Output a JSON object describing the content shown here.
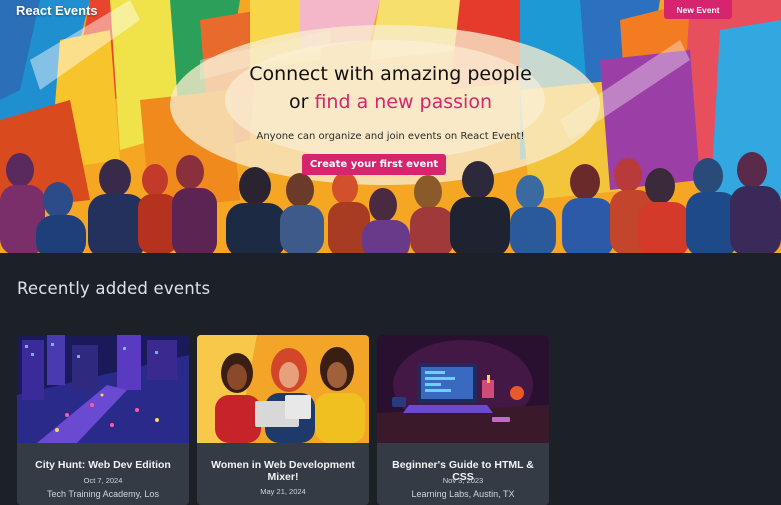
{
  "header": {
    "brand": "React Events",
    "new_event_label": "New Event"
  },
  "hero": {
    "headline_line1": "Connect with amazing people",
    "headline_or": "or",
    "headline_accent": "find a new passion",
    "subtext": "Anyone can organize and join events on React Event!",
    "cta_label": "Create your first event"
  },
  "recent": {
    "title": "Recently added events",
    "events": [
      {
        "title": "City Hunt: Web Dev Edition",
        "date": "Oct 7, 2024",
        "location": "Tech Training Academy, Los"
      },
      {
        "title": "Women in Web Development Mixer!",
        "date": "May 21, 2024",
        "location": ""
      },
      {
        "title": "Beginner's Guide to HTML & CSS",
        "date": "Nov 3, 2023",
        "location": "Learning Labs, Austin, TX"
      }
    ]
  },
  "colors": {
    "accent": "#d6246e",
    "page_bg": "#1c2128",
    "card_bg": "#353b44"
  }
}
